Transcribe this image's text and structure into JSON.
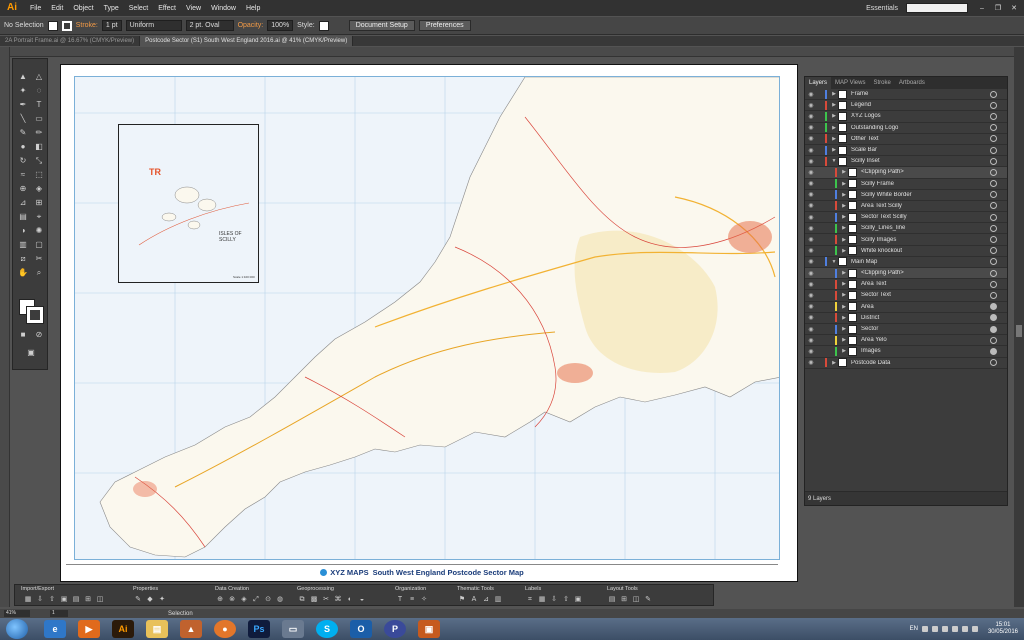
{
  "app": {
    "logo": "Ai",
    "menu": [
      "File",
      "Edit",
      "Object",
      "Type",
      "Select",
      "Effect",
      "View",
      "Window",
      "Help"
    ],
    "workspace": "Essentials",
    "window_controls": [
      "–",
      "❐",
      "✕"
    ]
  },
  "control": {
    "selection": "No Selection",
    "stroke_label": "Stroke:",
    "stroke_value": "1 pt",
    "profile": "Uniform",
    "brush": "2 pt. Oval",
    "opacity_label": "Opacity:",
    "opacity_value": "100%",
    "style_label": "Style:",
    "document_setup": "Document Setup",
    "preferences": "Preferences"
  },
  "tabs": [
    "2A Portrait Frame.ai @ 16.67% (CMYK/Preview)",
    "Postcode Sector (S1) South West England 2016.ai @ 41% (CMYK/Preview)"
  ],
  "map": {
    "inset_label_tr": "TR",
    "inset_caption": "ISLES OF SCILLY",
    "inset_scale": "Scale 1:100 000",
    "brand": "XYZ MAPS",
    "title": "South West England Postcode Sector Map"
  },
  "layers": {
    "tabs": [
      "Layers",
      "MAP Views",
      "Stroke",
      "Artboards"
    ],
    "rows": [
      {
        "name": "Frame",
        "color": "#4f7fe0",
        "level": 0,
        "expanded": false,
        "target": false,
        "selected": false
      },
      {
        "name": "Legend",
        "color": "#d84a3a",
        "level": 0,
        "expanded": false,
        "target": false,
        "selected": false
      },
      {
        "name": "XYZ Logos",
        "color": "#3cc44c",
        "level": 0,
        "expanded": false,
        "target": false,
        "selected": false
      },
      {
        "name": "Outstanding Logo",
        "color": "#3cc44c",
        "level": 0,
        "expanded": false,
        "target": false,
        "selected": false
      },
      {
        "name": "Other Text",
        "color": "#d84a3a",
        "level": 0,
        "expanded": false,
        "target": false,
        "selected": false
      },
      {
        "name": "Scale Bar",
        "color": "#4f7fe0",
        "level": 0,
        "expanded": false,
        "target": false,
        "selected": false
      },
      {
        "name": "Scilly Inset",
        "color": "#d84a3a",
        "level": 0,
        "expanded": true,
        "target": false,
        "selected": false
      },
      {
        "name": "<Clipping Path>",
        "color": "#d84a3a",
        "level": 1,
        "expanded": false,
        "target": false,
        "selected": true
      },
      {
        "name": "Scilly Frame",
        "color": "#3cc44c",
        "level": 1,
        "expanded": false,
        "target": false,
        "selected": false
      },
      {
        "name": "Scilly White Border",
        "color": "#4f7fe0",
        "level": 1,
        "expanded": false,
        "target": false,
        "selected": false
      },
      {
        "name": "Area Text Scilly",
        "color": "#d84a3a",
        "level": 1,
        "expanded": false,
        "target": false,
        "selected": false
      },
      {
        "name": "Sector Text Scilly",
        "color": "#4f7fe0",
        "level": 1,
        "expanded": false,
        "target": false,
        "selected": false
      },
      {
        "name": "Scilly_Lines_line",
        "color": "#3cc44c",
        "level": 1,
        "expanded": false,
        "target": false,
        "selected": false
      },
      {
        "name": "Scilly Images",
        "color": "#d84a3a",
        "level": 1,
        "expanded": false,
        "target": false,
        "selected": false
      },
      {
        "name": "White knockout",
        "color": "#3cc44c",
        "level": 1,
        "expanded": false,
        "target": false,
        "selected": false
      },
      {
        "name": "Main Map",
        "color": "#4f7fe0",
        "level": 0,
        "expanded": true,
        "target": false,
        "selected": false
      },
      {
        "name": "<Clipping Path>",
        "color": "#4f7fe0",
        "level": 1,
        "expanded": false,
        "target": false,
        "selected": true
      },
      {
        "name": "Area Text",
        "color": "#d84a3a",
        "level": 1,
        "expanded": false,
        "target": false,
        "selected": false
      },
      {
        "name": "Sector Text",
        "color": "#d84a3a",
        "level": 1,
        "expanded": false,
        "target": false,
        "selected": false
      },
      {
        "name": "Area",
        "color": "#f0d23a",
        "level": 1,
        "expanded": false,
        "target": true,
        "selected": false
      },
      {
        "name": "District",
        "color": "#d84a3a",
        "level": 1,
        "expanded": false,
        "target": true,
        "selected": false
      },
      {
        "name": "Sector",
        "color": "#4f7fe0",
        "level": 1,
        "expanded": false,
        "target": true,
        "selected": false
      },
      {
        "name": "Area Yelo",
        "color": "#f0d23a",
        "level": 1,
        "expanded": false,
        "target": false,
        "selected": false
      },
      {
        "name": "Images",
        "color": "#3cc44c",
        "level": 1,
        "expanded": false,
        "target": true,
        "selected": false
      },
      {
        "name": "Postcode Data",
        "color": "#d84a3a",
        "level": 0,
        "expanded": false,
        "target": false,
        "selected": false
      }
    ],
    "count": "9 Layers"
  },
  "bottom_panel": {
    "sections": [
      "Import/Export",
      "Properties",
      "Data Creation",
      "Geoprocessing",
      "Organization",
      "Thematic Tools",
      "Labels",
      "Layout Tools"
    ]
  },
  "status": {
    "zoom": "41%",
    "page": "1",
    "tool": "Selection"
  },
  "taskbar": {
    "lang": "EN",
    "time": "15:01",
    "date": "30/05/2016"
  }
}
